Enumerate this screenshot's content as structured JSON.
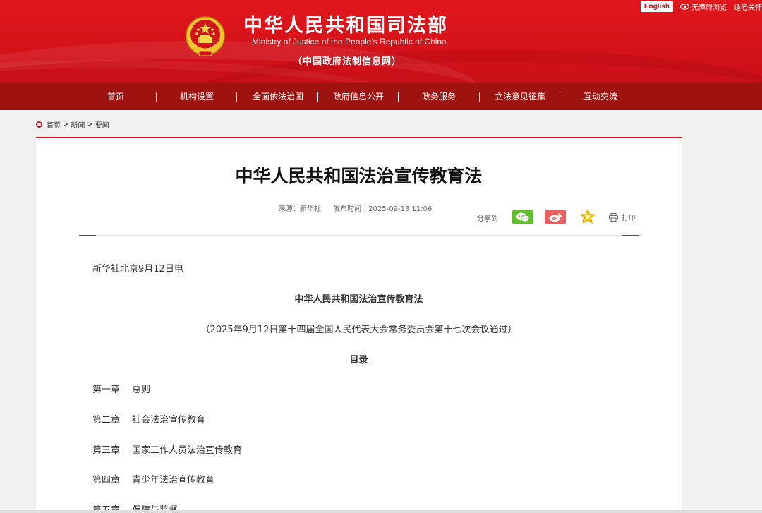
{
  "header": {
    "title": "中华人民共和国司法部",
    "subtitle_en": "Ministry of Justice of the People's Republic of China",
    "subtitle_cn": "（中国政府法制信息网）",
    "english_label": "English",
    "accessible_label": "无障碍浏览",
    "elderly_label": "适老关怀",
    "colors": {
      "header_red": "#d5121a",
      "nav_dark_red": "#9e1210"
    }
  },
  "nav": {
    "items": [
      {
        "label": "首页"
      },
      {
        "label": "机构设置"
      },
      {
        "label": "全面依法治国"
      },
      {
        "label": "政府信息公开"
      },
      {
        "label": "政务服务"
      },
      {
        "label": "立法意见征集"
      },
      {
        "label": "互动交流"
      }
    ],
    "separator": "|"
  },
  "breadcrumb": {
    "items": [
      "首页",
      "新闻",
      "要闻"
    ],
    "separator": ">"
  },
  "article": {
    "title": "中华人民共和国法治宣传教育法",
    "source": "来源：新华社",
    "publish_time": "发布时间：2025-09-13 11:06",
    "share_label": "分享到",
    "share_icons": [
      "wechat-icon",
      "weibo-icon",
      "favorite-star-icon"
    ],
    "print_label": "打印",
    "dateline": "新华社北京9月12日电",
    "law_title": "中华人民共和国法治宣传教育法",
    "law_note": "（2025年9月12日第十四届全国人民代表大会常务委员会第十七次会议通过）",
    "toc_heading": "目录",
    "chapters": [
      {
        "num": "第一章",
        "name": "总则"
      },
      {
        "num": "第二章",
        "name": "社会法治宣传教育"
      },
      {
        "num": "第三章",
        "name": "国家工作人员法治宣传教育"
      },
      {
        "num": "第四章",
        "name": "青少年法治宣传教育"
      },
      {
        "num": "第五章",
        "name": "保障与监督"
      }
    ]
  }
}
